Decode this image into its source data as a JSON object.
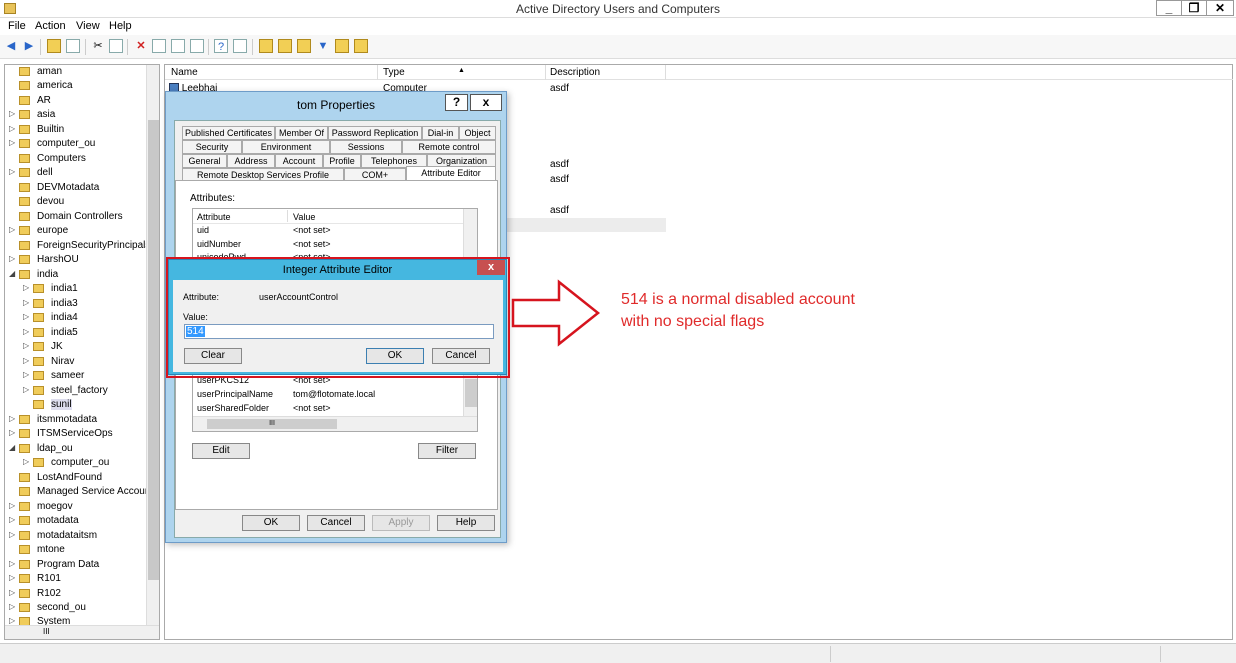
{
  "window": {
    "title": "Active Directory Users and Computers",
    "controls": {
      "minimize": "_",
      "maximize": "❐",
      "close": "✕"
    }
  },
  "menu": [
    "File",
    "Action",
    "View",
    "Help"
  ],
  "tree": {
    "items": [
      {
        "label": "aman",
        "expander": ""
      },
      {
        "label": "america",
        "expander": ""
      },
      {
        "label": "AR",
        "expander": ""
      },
      {
        "label": "asia",
        "expander": "▷"
      },
      {
        "label": "Builtin",
        "expander": "▷"
      },
      {
        "label": "computer_ou",
        "expander": "▷"
      },
      {
        "label": "Computers",
        "expander": ""
      },
      {
        "label": "dell",
        "expander": "▷"
      },
      {
        "label": "DEVMotadata",
        "expander": ""
      },
      {
        "label": "devou",
        "expander": ""
      },
      {
        "label": "Domain Controllers",
        "expander": ""
      },
      {
        "label": "europe",
        "expander": "▷"
      },
      {
        "label": "ForeignSecurityPrincipals",
        "expander": ""
      },
      {
        "label": "HarshOU",
        "expander": "▷"
      },
      {
        "label": "india",
        "expander": "◢"
      },
      {
        "label": "india1",
        "expander": "▷"
      },
      {
        "label": "india3",
        "expander": "▷"
      },
      {
        "label": "india4",
        "expander": "▷"
      },
      {
        "label": "india5",
        "expander": "▷"
      },
      {
        "label": "JK",
        "expander": "▷"
      },
      {
        "label": "Nirav",
        "expander": "▷"
      },
      {
        "label": "sameer",
        "expander": "▷"
      },
      {
        "label": "steel_factory",
        "expander": "▷"
      },
      {
        "label": "sunil",
        "expander": ""
      },
      {
        "label": "itsmmotadata",
        "expander": "▷"
      },
      {
        "label": "ITSMServiceOps",
        "expander": "▷"
      },
      {
        "label": "ldap_ou",
        "expander": "◢"
      },
      {
        "label": "computer_ou",
        "expander": "▷"
      },
      {
        "label": "LostAndFound",
        "expander": ""
      },
      {
        "label": "Managed Service Accoun",
        "expander": ""
      },
      {
        "label": "moegov",
        "expander": "▷"
      },
      {
        "label": "motadata",
        "expander": "▷"
      },
      {
        "label": "motadataitsm",
        "expander": "▷"
      },
      {
        "label": "mtone",
        "expander": ""
      },
      {
        "label": "Program Data",
        "expander": "▷"
      },
      {
        "label": "R101",
        "expander": "▷"
      },
      {
        "label": "R102",
        "expander": "▷"
      },
      {
        "label": "second_ou",
        "expander": "▷"
      },
      {
        "label": "System",
        "expander": "▷"
      }
    ],
    "hscroll_thumb": "III"
  },
  "list": {
    "columns": [
      "Name",
      "Type",
      "Description"
    ],
    "sort_indicator": "▲",
    "rows": [
      {
        "name": "Leebhai",
        "type": "Computer",
        "description": "asdf"
      },
      {
        "name": "",
        "type": "",
        "description": "asdf"
      },
      {
        "name": "",
        "type": "",
        "description": "asdf"
      },
      {
        "name": "",
        "type": "",
        "description": "asdf"
      }
    ]
  },
  "properties": {
    "title": "tom Properties",
    "help_btn": "?",
    "close_btn": "x",
    "tabs_row1": [
      "Published Certificates",
      "Member Of",
      "Password Replication",
      "Dial-in",
      "Object"
    ],
    "tabs_row2": [
      "Security",
      "Environment",
      "Sessions",
      "Remote control"
    ],
    "tabs_row3": [
      "General",
      "Address",
      "Account",
      "Profile",
      "Telephones",
      "Organization"
    ],
    "tabs_row4": [
      "Remote Desktop Services Profile",
      "COM+",
      "Attribute Editor"
    ],
    "attributes_label": "Attributes:",
    "attr_headers": [
      "Attribute",
      "Value"
    ],
    "attr_top": [
      {
        "attr": "uid",
        "value": "<not set>"
      },
      {
        "attr": "uidNumber",
        "value": "<not set>"
      },
      {
        "attr": "unicodePwd",
        "value": "<not set>"
      }
    ],
    "attr_bottom": [
      {
        "attr": "userPKCS12",
        "value": "<not set>"
      },
      {
        "attr": "userPrincipalName",
        "value": "tom@flotomate.local"
      },
      {
        "attr": "userSharedFolder",
        "value": "<not set>"
      }
    ],
    "hscroll_thumb": "III",
    "edit_btn": "Edit",
    "filter_btn": "Filter",
    "ok_btn": "OK",
    "cancel_btn": "Cancel",
    "apply_btn": "Apply",
    "help_btn_bottom": "Help"
  },
  "integer_editor": {
    "title": "Integer Attribute Editor",
    "close": "x",
    "attribute_label": "Attribute:",
    "attribute_value": "userAccountControl",
    "value_label": "Value:",
    "value": "514",
    "clear_btn": "Clear",
    "ok_btn": "OK",
    "cancel_btn": "Cancel"
  },
  "annotation": {
    "text": "514 is a normal disabled account with no special flags",
    "color": "#e02b2b"
  }
}
